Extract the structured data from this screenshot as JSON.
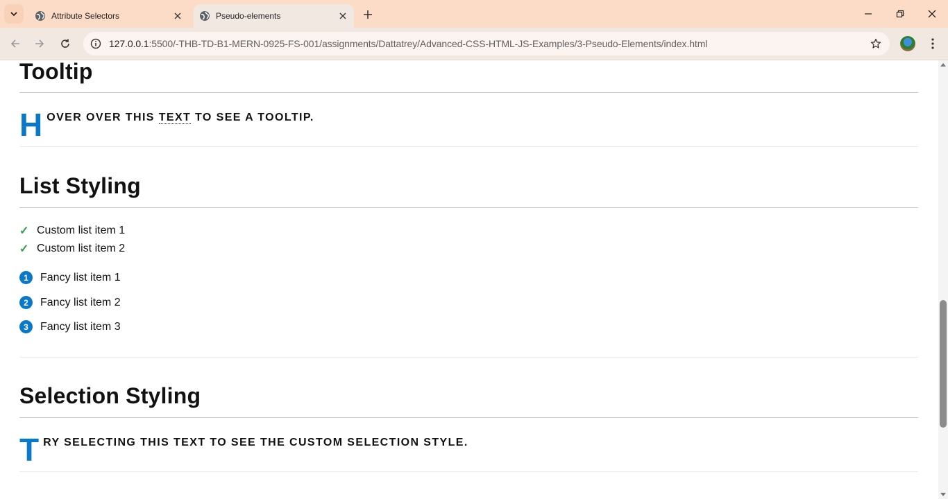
{
  "browser": {
    "tabs": [
      {
        "title": "Attribute Selectors",
        "active": false
      },
      {
        "title": "Pseudo-elements",
        "active": true
      }
    ],
    "url_host": "127.0.0.1",
    "url_rest": ":5500/-THB-TD-B1-MERN-0925-FS-001/assignments/Dattatrey/Advanced-CSS-HTML-JS-Examples/3-Pseudo-Elements/index.html"
  },
  "page": {
    "tooltip": {
      "heading": "Tooltip",
      "dropcap": "H",
      "text_before": "over over this ",
      "tooltip_word": "text",
      "text_after": " to see a tooltip."
    },
    "list_styling": {
      "heading": "List Styling",
      "custom_items": [
        "Custom list item 1",
        "Custom list item 2"
      ],
      "fancy_items": [
        {
          "num": "1",
          "label": "Fancy list item 1"
        },
        {
          "num": "2",
          "label": "Fancy list item 2"
        },
        {
          "num": "3",
          "label": "Fancy list item 3"
        }
      ]
    },
    "selection_styling": {
      "heading": "Selection Styling",
      "dropcap": "T",
      "text": "ry selecting this text to see the custom selection style."
    }
  },
  "colors": {
    "accent": "#0a78c8",
    "check": "#2e9e4b",
    "tabstrip": "#fcdcc6"
  }
}
